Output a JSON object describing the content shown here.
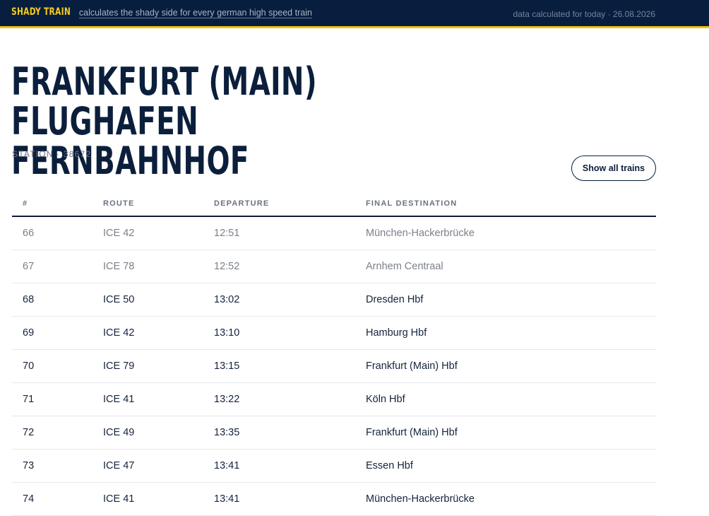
{
  "header": {
    "brand": "SHADY TRAIN",
    "tagline": "calculates the shady side for every german high speed train",
    "data_info": "data calculated for today · 26.08.2026"
  },
  "station": {
    "name": "FRANKFURT (MAIN) FLUGHAFEN FERNBAHNHOF",
    "meta": "STATION · 38672",
    "show_all_label": "Show all trains"
  },
  "table": {
    "columns": [
      "#",
      "ROUTE",
      "DEPARTURE",
      "FINAL DESTINATION"
    ],
    "rows": [
      {
        "n": "66",
        "route": "ICE 42",
        "dep": "12:51",
        "dest": "München-Hackerbrücke",
        "past": true
      },
      {
        "n": "67",
        "route": "ICE 78",
        "dep": "12:52",
        "dest": "Arnhem Centraal",
        "past": true
      },
      {
        "n": "68",
        "route": "ICE 50",
        "dep": "13:02",
        "dest": "Dresden Hbf",
        "past": false
      },
      {
        "n": "69",
        "route": "ICE 42",
        "dep": "13:10",
        "dest": "Hamburg Hbf",
        "past": false
      },
      {
        "n": "70",
        "route": "ICE 79",
        "dep": "13:15",
        "dest": "Frankfurt (Main) Hbf",
        "past": false
      },
      {
        "n": "71",
        "route": "ICE 41",
        "dep": "13:22",
        "dest": "Köln Hbf",
        "past": false
      },
      {
        "n": "72",
        "route": "ICE 49",
        "dep": "13:35",
        "dest": "Frankfurt (Main) Hbf",
        "past": false
      },
      {
        "n": "73",
        "route": "ICE 47",
        "dep": "13:41",
        "dest": "Essen Hbf",
        "past": false
      },
      {
        "n": "74",
        "route": "ICE 41",
        "dep": "13:41",
        "dest": "München-Hackerbrücke",
        "past": false
      }
    ]
  }
}
